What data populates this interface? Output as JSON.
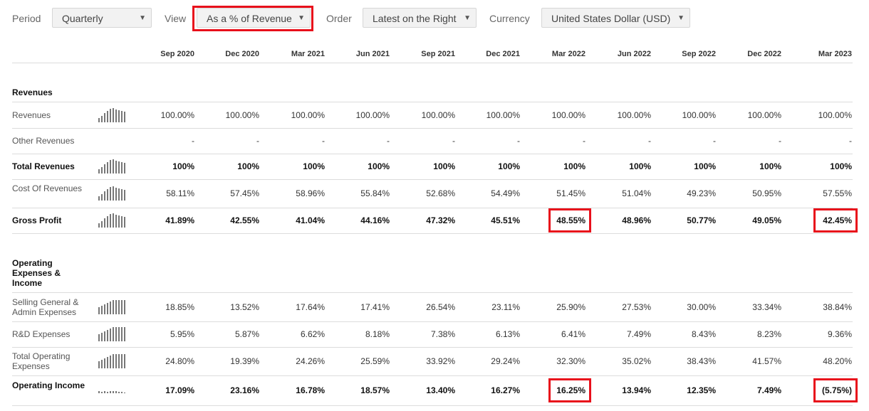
{
  "toolbar": {
    "period_label": "Period",
    "period_value": "Quarterly",
    "view_label": "View",
    "view_value": "As a % of Revenue",
    "order_label": "Order",
    "order_value": "Latest on the Right",
    "currency_label": "Currency",
    "currency_value": "United States Dollar (USD)",
    "caret": "▼"
  },
  "columns": [
    "Sep 2020",
    "Dec 2020",
    "Mar 2021",
    "Jun 2021",
    "Sep 2021",
    "Dec 2021",
    "Mar 2022",
    "Jun 2022",
    "Sep 2022",
    "Dec 2022",
    "Mar 2023"
  ],
  "sections": [
    {
      "title": "Revenues",
      "rows": [
        {
          "label": "Revenues",
          "bold": false,
          "spark": true,
          "values": [
            "100.00%",
            "100.00%",
            "100.00%",
            "100.00%",
            "100.00%",
            "100.00%",
            "100.00%",
            "100.00%",
            "100.00%",
            "100.00%",
            "100.00%"
          ]
        },
        {
          "label": "Other Revenues",
          "bold": false,
          "spark": false,
          "values": [
            "-",
            "-",
            "-",
            "-",
            "-",
            "-",
            "-",
            "-",
            "-",
            "-",
            "-"
          ]
        },
        {
          "label": "Total Revenues",
          "bold": true,
          "spark": true,
          "values": [
            "100%",
            "100%",
            "100%",
            "100%",
            "100%",
            "100%",
            "100%",
            "100%",
            "100%",
            "100%",
            "100%"
          ]
        },
        {
          "label": "Cost Of Revenues",
          "bold": false,
          "spark": true,
          "values": [
            "58.11%",
            "57.45%",
            "58.96%",
            "55.84%",
            "52.68%",
            "54.49%",
            "51.45%",
            "51.04%",
            "49.23%",
            "50.95%",
            "57.55%"
          ]
        },
        {
          "label": "Gross Profit",
          "bold": true,
          "spark": true,
          "values": [
            "41.89%",
            "42.55%",
            "41.04%",
            "44.16%",
            "47.32%",
            "45.51%",
            "48.55%",
            "48.96%",
            "50.77%",
            "49.05%",
            "42.45%"
          ]
        }
      ]
    },
    {
      "title": "Operating Expenses & Income",
      "rows": [
        {
          "label": "Selling General & Admin Expenses",
          "bold": false,
          "spark": true,
          "values": [
            "18.85%",
            "13.52%",
            "17.64%",
            "17.41%",
            "26.54%",
            "23.11%",
            "25.90%",
            "27.53%",
            "30.00%",
            "33.34%",
            "38.84%"
          ]
        },
        {
          "label": "R&D Expenses",
          "bold": false,
          "spark": true,
          "values": [
            "5.95%",
            "5.87%",
            "6.62%",
            "8.18%",
            "7.38%",
            "6.13%",
            "6.41%",
            "7.49%",
            "8.43%",
            "8.23%",
            "9.36%"
          ]
        },
        {
          "label": "Total Operating Expenses",
          "bold": false,
          "spark": true,
          "values": [
            "24.80%",
            "19.39%",
            "24.26%",
            "25.59%",
            "33.92%",
            "29.24%",
            "32.30%",
            "35.02%",
            "38.43%",
            "41.57%",
            "48.20%"
          ]
        },
        {
          "label": "Operating Income",
          "bold": true,
          "spark": true,
          "values": [
            "17.09%",
            "23.16%",
            "16.78%",
            "18.57%",
            "13.40%",
            "16.27%",
            "16.25%",
            "13.94%",
            "12.35%",
            "7.49%",
            "(5.75%)"
          ]
        }
      ]
    }
  ],
  "highlight_color": "#e8101b"
}
